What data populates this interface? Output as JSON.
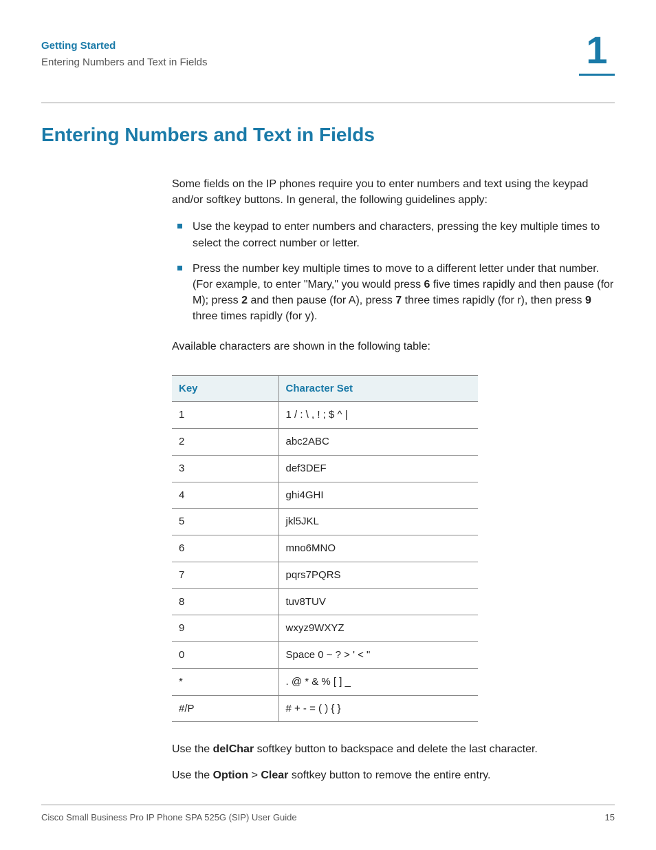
{
  "header": {
    "chapter": "Getting Started",
    "section": "Entering Numbers and Text in Fields",
    "number": "1"
  },
  "h1": "Entering Numbers and Text in Fields",
  "intro": "Some fields on the IP phones require you to enter numbers and text using the keypad and/or softkey buttons. In general, the following guidelines apply:",
  "bullets": [
    "Use the keypad to enter numbers and characters, pressing the key multiple times to select the correct number or letter.",
    {
      "pre": "Press the number key multiple times to move to a different letter under that number. (For example, to enter \"Mary,\" you would press ",
      "b1": "6",
      "mid1": " five times rapidly and then pause (for M); press ",
      "b2": "2",
      "mid2": " and then pause (for A), press ",
      "b3": "7",
      "mid3": " three times rapidly (for r), then press ",
      "b4": "9",
      "post": " three times rapidly (for y)."
    }
  ],
  "table_intro": "Available characters are shown in the following table:",
  "table": {
    "headers": [
      "Key",
      "Character Set"
    ],
    "rows": [
      [
        "1",
        "1 / : \\ , ! ; $ ^ |"
      ],
      [
        "2",
        "abc2ABC"
      ],
      [
        "3",
        "def3DEF"
      ],
      [
        "4",
        "ghi4GHI"
      ],
      [
        "5",
        "jkl5JKL"
      ],
      [
        "6",
        "mno6MNO"
      ],
      [
        "7",
        "pqrs7PQRS"
      ],
      [
        "8",
        "tuv8TUV"
      ],
      [
        "9",
        "wxyz9WXYZ"
      ],
      [
        "0",
        "Space 0 ~ ? > ' < \""
      ],
      [
        "*",
        ". @ * & % [ ] _"
      ],
      [
        "#/P",
        "# + - = ( ) { }"
      ]
    ]
  },
  "after": {
    "p1_pre": "Use the ",
    "p1_b": "delChar",
    "p1_post": " softkey button to backspace and delete the last character.",
    "p2_pre": "Use the ",
    "p2_b1": "Option",
    "p2_sep": " > ",
    "p2_b2": "Clear",
    "p2_post": " softkey button to remove the entire entry."
  },
  "footer": {
    "left": "Cisco Small Business Pro IP Phone SPA 525G (SIP) User Guide",
    "right": "15"
  }
}
